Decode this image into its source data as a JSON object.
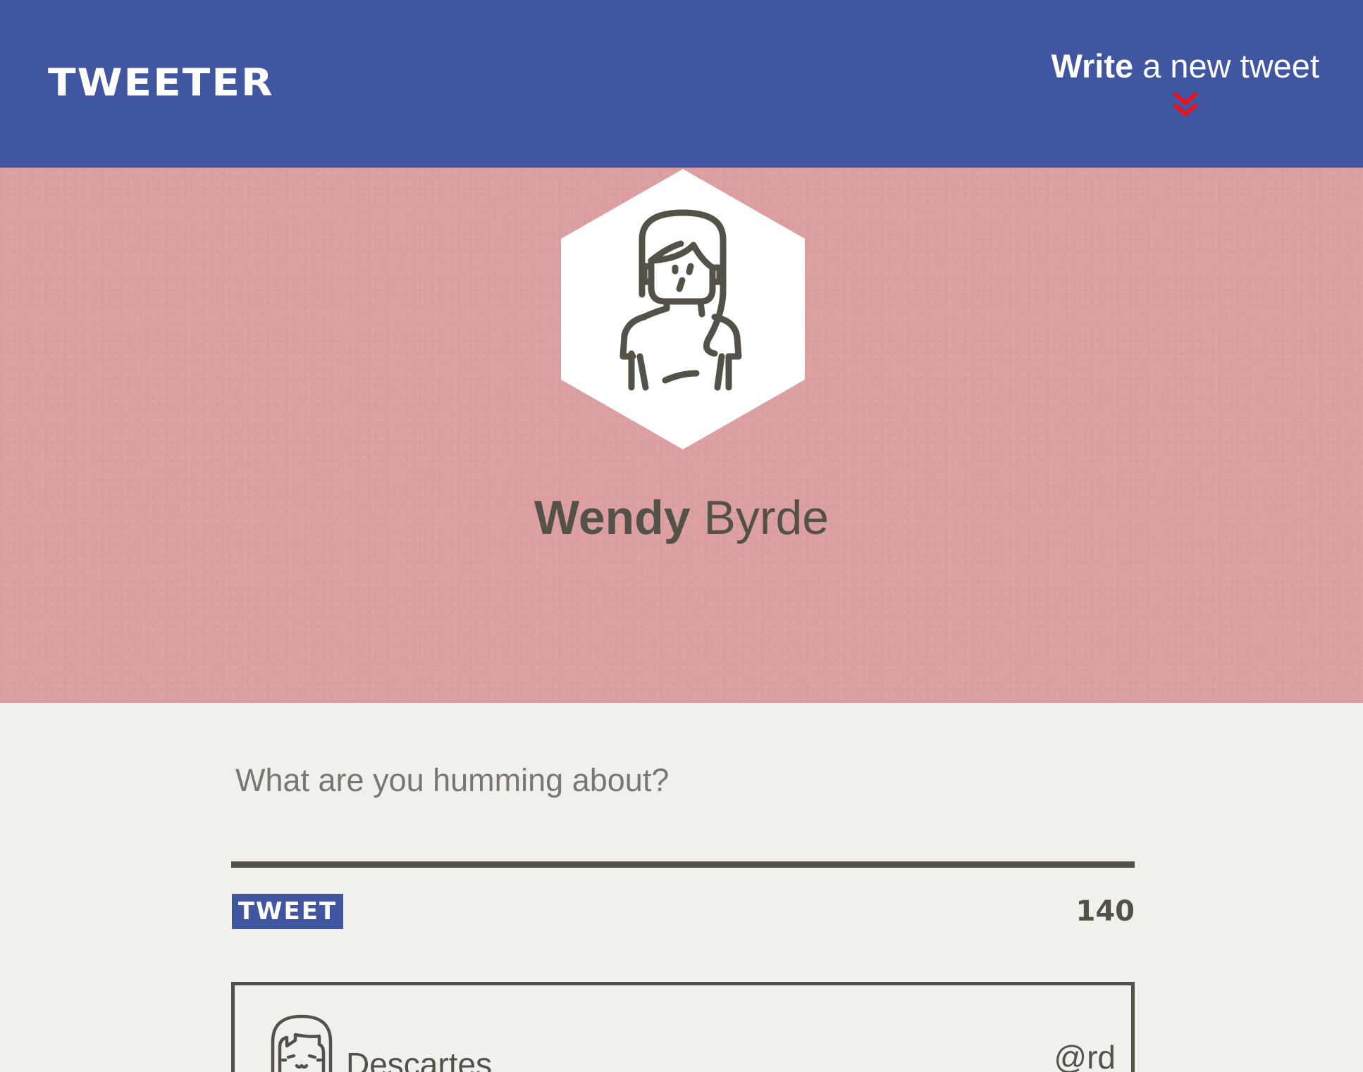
{
  "header": {
    "brand": "TWEETER",
    "compose_toggle": {
      "bold": "Write",
      "rest": "a new tweet",
      "icon": "chevron-double-down-icon",
      "icon_color": "#e8121e"
    }
  },
  "profile": {
    "avatar_icon": "woman-avatar-icon",
    "first_name": "Wendy",
    "last_name": "Byrde"
  },
  "composer": {
    "placeholder": "What are you humming about?",
    "value": "",
    "submit_label": "TWEET",
    "char_count": "140"
  },
  "tweets": [
    {
      "avatar_icon": "smiling-girl-avatar-icon",
      "author": "Descartes",
      "handle": "@rd"
    }
  ],
  "colors": {
    "header_bg": "#4156a1",
    "profile_bg": "#dca0a3",
    "page_bg": "#f2f0ec",
    "text": "#545149",
    "accent_red": "#e8121e"
  }
}
